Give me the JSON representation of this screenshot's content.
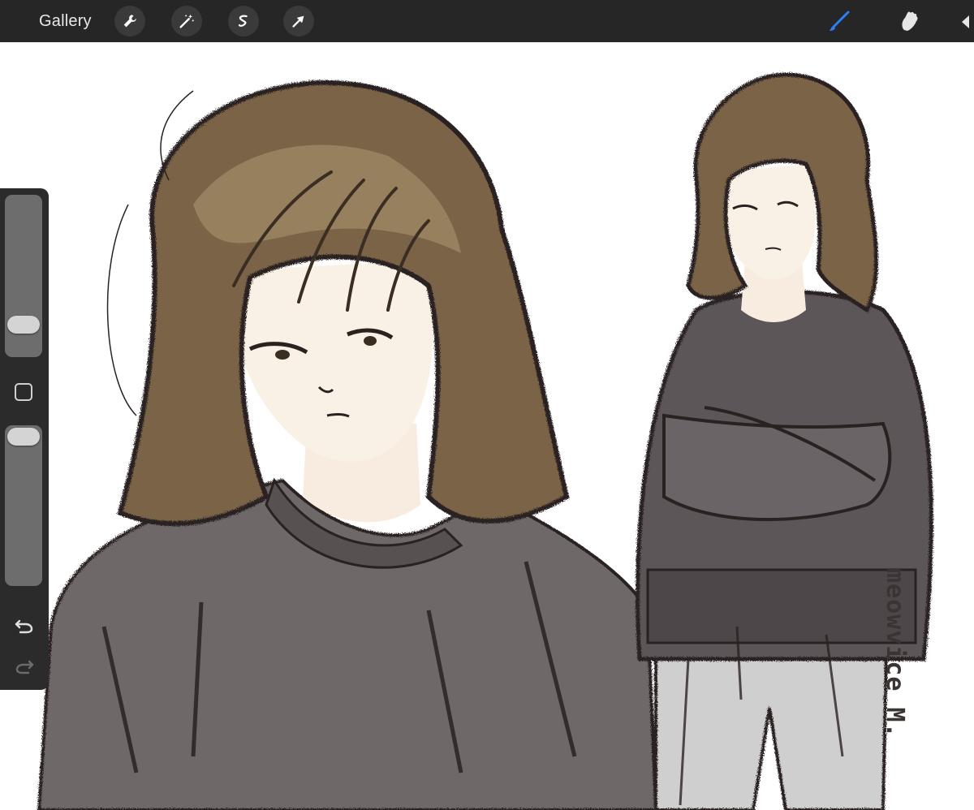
{
  "topbar": {
    "gallery_label": "Gallery",
    "left_tools": [
      {
        "icon": "wrench-icon",
        "name": "actions"
      },
      {
        "icon": "magic-wand-icon",
        "name": "adjustments"
      },
      {
        "icon": "selection-icon",
        "name": "selection"
      },
      {
        "icon": "arrow-cursor-icon",
        "name": "transform"
      }
    ],
    "right_tools": [
      {
        "icon": "brush-icon",
        "name": "paint",
        "active": true
      },
      {
        "icon": "smudge-icon",
        "name": "smudge",
        "active": false
      }
    ]
  },
  "sidebar": {
    "size_slider_level": 0.15,
    "opacity_slider_level": 1.0,
    "buttons": [
      "modify-square-icon",
      "undo-icon",
      "redo-icon"
    ]
  },
  "canvas": {
    "signature_text": "meowvice M."
  },
  "colors": {
    "toolbar_bg": "#262626",
    "active_tool": "#2f7df6",
    "hair": "#7a6446",
    "sweater": "#5c5658",
    "skin": "#f7ecdf",
    "pants": "#c9c9c9",
    "ink": "#2a2220"
  }
}
